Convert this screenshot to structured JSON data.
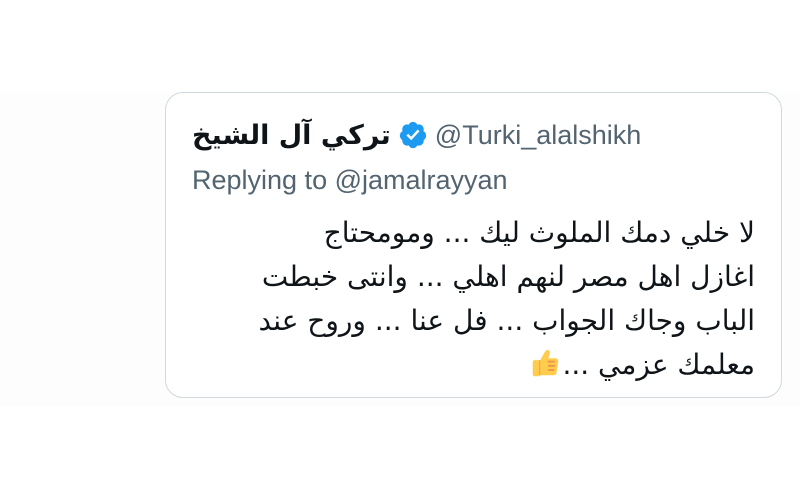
{
  "quoted_tweet": {
    "display_name": "تركي آل الشيخ",
    "handle": "@Turki_alalshikh",
    "verified": true,
    "reply_prefix": "Replying to",
    "reply_handle": "@jamalrayyan",
    "text_lines": [
      "لا خلي دمك الملوث ليك ... ومومحتاج",
      "اغازل اهل مصر لنهم اهلي ... وانتى خبطت",
      "الباب وجاك الجواب ... فل عنا ... وروح عند",
      "معلمك عزمي ..."
    ],
    "emoji": "thumbs-up-icon"
  },
  "colors": {
    "verified_blue": "#1d9bf0",
    "text_primary": "#0f1419",
    "text_secondary": "#536471",
    "card_border": "#cfd9de"
  }
}
